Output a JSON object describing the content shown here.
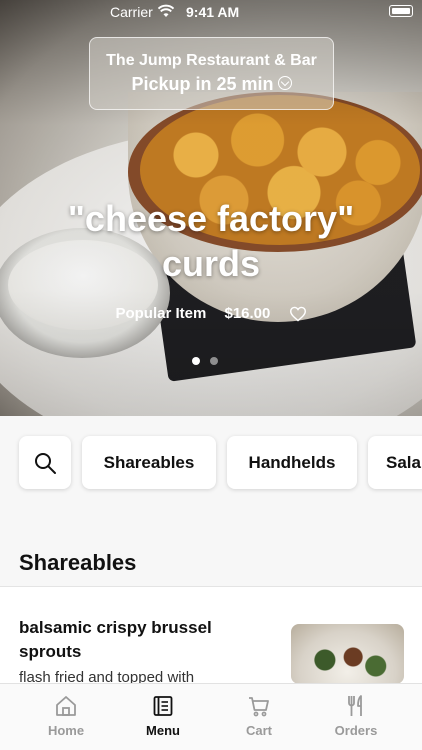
{
  "status_bar": {
    "carrier": "Carrier",
    "time": "9:41 AM"
  },
  "location": {
    "name": "The Jump Restaurant & Bar",
    "pickup": "Pickup in 25 min"
  },
  "hero": {
    "title_line1": "\"cheese factory\"",
    "title_line2": "curds",
    "tag": "Popular Item",
    "price": "$16.00",
    "carousel": {
      "count": 2,
      "active_index": 0
    }
  },
  "categories": [
    "Shareables",
    "Handhelds",
    "Sala"
  ],
  "section": {
    "title": "Shareables"
  },
  "items": [
    {
      "name": "balsamic crispy brussel sprouts",
      "description": "flash fried and topped with"
    }
  ],
  "tabs": [
    {
      "label": "Home",
      "icon": "home-icon",
      "active": false
    },
    {
      "label": "Menu",
      "icon": "menu-book-icon",
      "active": true
    },
    {
      "label": "Cart",
      "icon": "cart-icon",
      "active": false
    },
    {
      "label": "Orders",
      "icon": "fork-knife-icon",
      "active": false
    }
  ],
  "colors": {
    "active_tab": "#111111",
    "inactive_tab": "#9a9a9a",
    "background": "#f7f7f7"
  }
}
